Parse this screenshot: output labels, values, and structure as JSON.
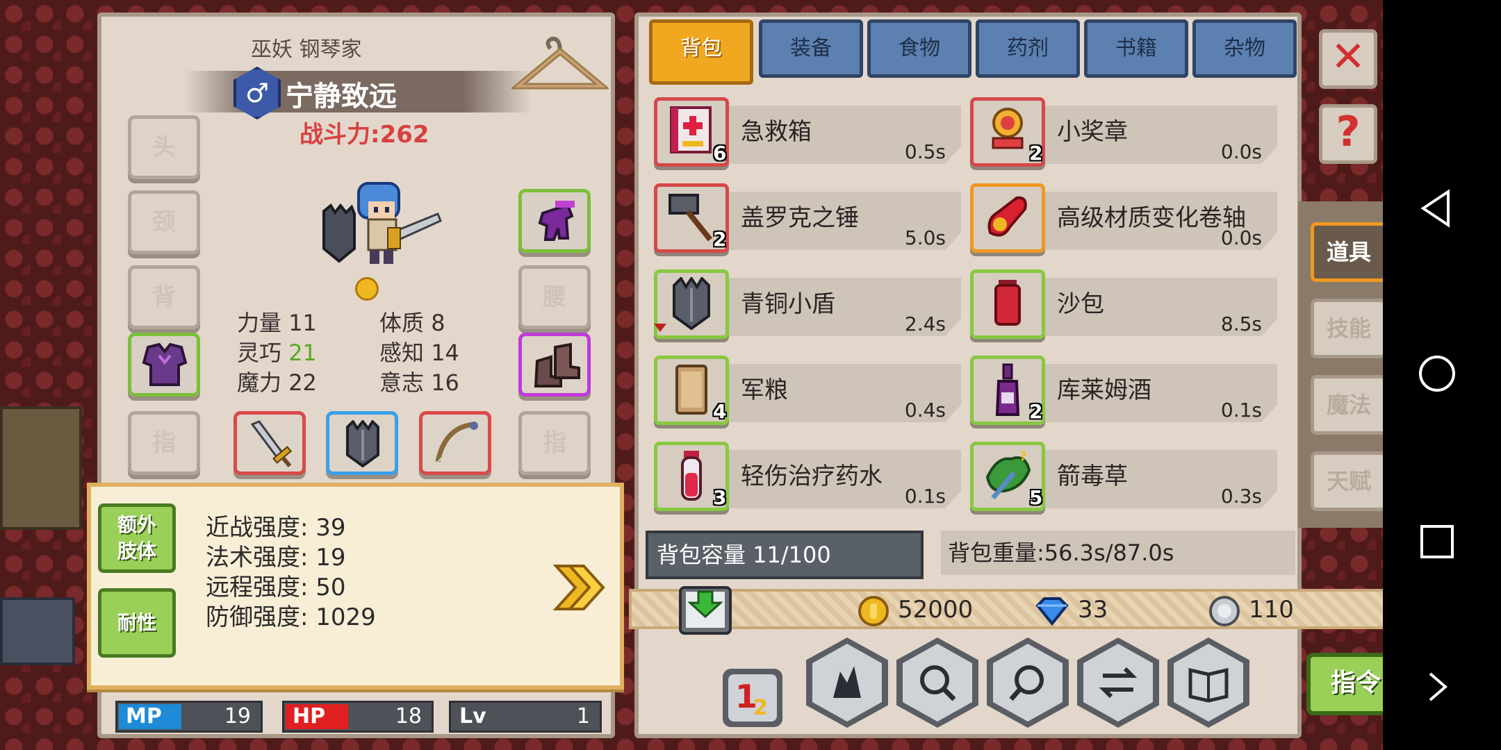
{
  "character": {
    "class_label": "巫妖 钢琴家",
    "gender_symbol": "♂",
    "name": "宁静致远",
    "combat_power": "战斗力:262",
    "slots": {
      "head": "头",
      "neck": "颈",
      "back": "背",
      "waist": "腰",
      "ring_left": "指",
      "ring_right": "指"
    },
    "stats": [
      {
        "label": "力量",
        "value": "11"
      },
      {
        "label": "体质",
        "value": "8"
      },
      {
        "label": "灵巧",
        "value": "21"
      },
      {
        "label": "感知",
        "value": "14"
      },
      {
        "label": "魔力",
        "value": "22"
      },
      {
        "label": "意志",
        "value": "16"
      }
    ],
    "bars": {
      "mp_label": "MP",
      "mp_value": "19",
      "hp_label": "HP",
      "hp_value": "18",
      "lv_label": "Lv",
      "lv_value": "1"
    }
  },
  "info_box": {
    "btn_extra_limbs": "额外肢体",
    "btn_extra_limbs_line1": "额外",
    "btn_extra_limbs_line2": "肢体",
    "btn_endurance": "耐性",
    "lines": [
      "近战强度: 39",
      "法术强度: 19",
      "远程强度: 50",
      "防御强度: 1029"
    ]
  },
  "inventory": {
    "tabs": [
      "背包",
      "装备",
      "食物",
      "药剂",
      "书籍",
      "杂物"
    ],
    "active_tab": "背包",
    "items": [
      {
        "name": "急救箱",
        "weight": "0.5s",
        "qty": "6",
        "icon": "first-aid-kit-icon"
      },
      {
        "name": "小奖章",
        "weight": "0.0s",
        "qty": "2",
        "icon": "medal-icon"
      },
      {
        "name": "盖罗克之锤",
        "weight": "5.0s",
        "qty": "2",
        "icon": "hammer-icon"
      },
      {
        "name": "高级材质变化卷轴",
        "weight": "0.0s",
        "qty": "",
        "icon": "scroll-icon"
      },
      {
        "name": "青铜小盾",
        "weight": "2.4s",
        "qty": "",
        "icon": "shield-icon"
      },
      {
        "name": "沙包",
        "weight": "8.5s",
        "qty": "",
        "icon": "sandbag-icon"
      },
      {
        "name": "军粮",
        "weight": "0.4s",
        "qty": "4",
        "icon": "ration-icon"
      },
      {
        "name": "库莱姆酒",
        "weight": "0.1s",
        "qty": "2",
        "icon": "wine-bottle-icon"
      },
      {
        "name": "轻伤治疗药水",
        "weight": "0.1s",
        "qty": "3",
        "icon": "potion-icon"
      },
      {
        "name": "箭毒草",
        "weight": "0.3s",
        "qty": "5",
        "icon": "herb-icon"
      }
    ],
    "capacity": "背包容量 11/100",
    "weight": "背包重量:56.3s/87.0s"
  },
  "currency": {
    "gold": "52000",
    "diamond": "33",
    "silver": "110"
  },
  "side_tabs": [
    "道具",
    "技能",
    "魔法",
    "天赋"
  ],
  "command_button": "指令",
  "sort_badge": "12",
  "colors": {
    "tab_active": "#f0a820",
    "tab_inactive": "#5c80b0",
    "combat_power": "#d84040",
    "green_button": "#9ad058",
    "mp": "#1e8ad8",
    "hp": "#e02020"
  }
}
